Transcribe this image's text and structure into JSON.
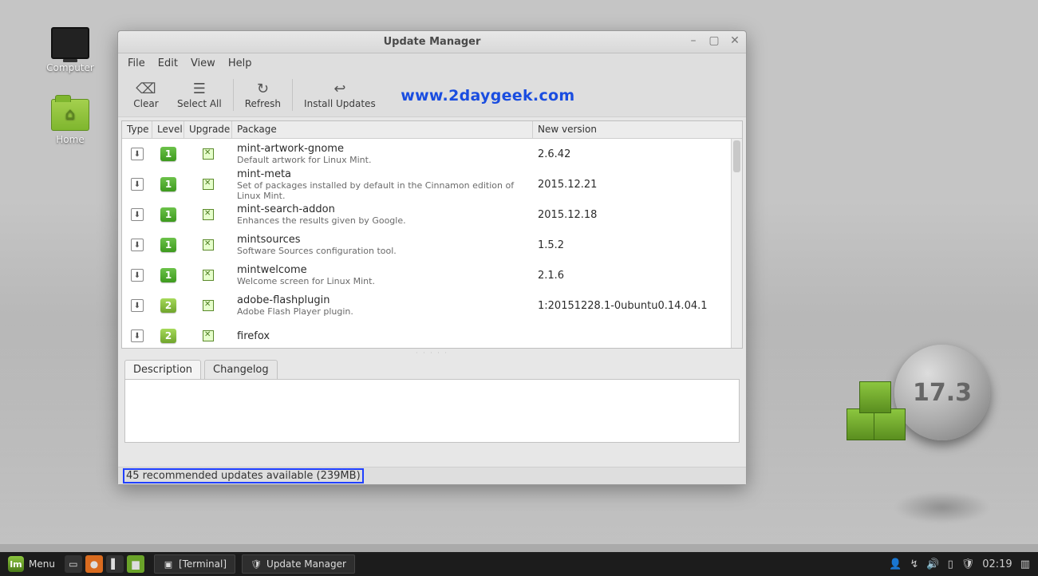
{
  "desktop": {
    "icons": [
      {
        "name": "computer",
        "label": "Computer"
      },
      {
        "name": "home",
        "label": "Home"
      }
    ],
    "version_disc": "17.3"
  },
  "window": {
    "title": "Update Manager",
    "menus": [
      "File",
      "Edit",
      "View",
      "Help"
    ],
    "toolbar": {
      "clear": "Clear",
      "select_all": "Select All",
      "refresh": "Refresh",
      "install": "Install Updates"
    },
    "watermark": "www.2daygeek.com",
    "columns": {
      "type": "Type",
      "level": "Level",
      "upgrade": "Upgrade",
      "package": "Package",
      "new_version": "New version"
    },
    "rows": [
      {
        "level": "1",
        "name": "mint-artwork-gnome",
        "desc": "Default artwork for Linux Mint.",
        "version": "2.6.42"
      },
      {
        "level": "1",
        "name": "mint-meta",
        "desc": "Set of packages installed by default in the Cinnamon edition of Linux Mint.",
        "version": "2015.12.21"
      },
      {
        "level": "1",
        "name": "mint-search-addon",
        "desc": "Enhances the results given by Google.",
        "version": "2015.12.18"
      },
      {
        "level": "1",
        "name": "mintsources",
        "desc": "Software Sources configuration tool.",
        "version": "1.5.2"
      },
      {
        "level": "1",
        "name": "mintwelcome",
        "desc": "Welcome screen for Linux Mint.",
        "version": "2.1.6"
      },
      {
        "level": "2",
        "name": "adobe-flashplugin",
        "desc": "Adobe Flash Player plugin.",
        "version": "1:20151228.1-0ubuntu0.14.04.1"
      },
      {
        "level": "2",
        "name": "firefox",
        "desc": "",
        "version": ""
      }
    ],
    "tabs": {
      "description": "Description",
      "changelog": "Changelog"
    },
    "status": "45 recommended updates available (239MB)"
  },
  "taskbar": {
    "menu": "Menu",
    "items": [
      {
        "label": "[Terminal]"
      },
      {
        "label": "Update Manager"
      }
    ],
    "clock": "02:19"
  }
}
